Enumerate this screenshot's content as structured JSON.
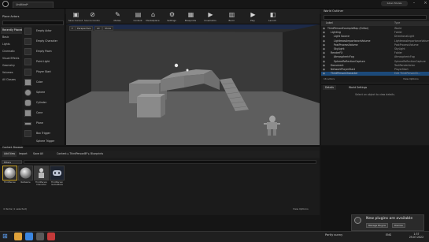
{
  "window": {
    "tab_title": "Untitled*",
    "user": "Iulian Sturza",
    "minimize_icon": "minimize-icon",
    "close_icon": "close-icon"
  },
  "menu": [
    "File",
    "Edit",
    "Window",
    "Help"
  ],
  "place_actors": {
    "title": "Place Actors",
    "categories": [
      "Recently Placed",
      "Basic",
      "Lights",
      "Cinematic",
      "Visual Effects",
      "Geometry",
      "Volumes",
      "All Classes"
    ],
    "items": [
      "Empty Actor",
      "Empty Character",
      "Empty Pawn",
      "Point Light",
      "Player Start",
      "Cube",
      "Sphere",
      "Cylinder",
      "Cone",
      "Plane",
      "Box Trigger",
      "Sphere Trigger"
    ]
  },
  "toolbar": {
    "buttons": [
      {
        "label": "Save Current",
        "icon": "save-icon"
      },
      {
        "label": "Source Control",
        "icon": "source-control-icon"
      },
      {
        "label": "Modes",
        "icon": "modes-icon"
      },
      {
        "label": "Content",
        "icon": "content-icon"
      },
      {
        "label": "Marketplace",
        "icon": "marketplace-icon"
      },
      {
        "label": "Settings",
        "icon": "settings-icon"
      },
      {
        "label": "Blueprints",
        "icon": "blueprints-icon"
      },
      {
        "label": "Cinematics",
        "icon": "cinematics-icon"
      },
      {
        "label": "Build",
        "icon": "build-icon"
      },
      {
        "label": "Play",
        "icon": "play-icon"
      },
      {
        "label": "Launch",
        "icon": "launch-icon"
      }
    ]
  },
  "viewport": {
    "buttons": [
      "Perspective",
      "Lit",
      "Show"
    ]
  },
  "outliner": {
    "title": "World Outliner",
    "columns": {
      "label": "Label",
      "type": "Type"
    },
    "rows": [
      {
        "label": "ThirdPersonExampleMap (Editor)",
        "type": "World",
        "indent": 0
      },
      {
        "label": "Lighting",
        "type": "Folder",
        "indent": 1
      },
      {
        "label": "Light Source",
        "type": "DirectionalLight",
        "indent": 2
      },
      {
        "label": "LightmassImportanceVolume",
        "type": "LightmassImportanceVolume",
        "indent": 2
      },
      {
        "label": "PostProcessVolume",
        "type": "PostProcessVolume",
        "indent": 2
      },
      {
        "label": "SkyLight",
        "type": "SkyLight",
        "indent": 2
      },
      {
        "label": "RenderFX",
        "type": "Folder",
        "indent": 1
      },
      {
        "label": "AtmosphericFog",
        "type": "AtmosphericFog",
        "indent": 2
      },
      {
        "label": "SphereReflectionCapture",
        "type": "SphereReflectionCapture",
        "indent": 2
      },
      {
        "label": "Document",
        "type": "TextRenderActor",
        "indent": 1
      },
      {
        "label": "NetworkPlayerStart",
        "type": "PlayerStart",
        "indent": 1
      },
      {
        "label": "ThirdPersonCharacter",
        "type": "Edit ThirdPersonCh...",
        "indent": 1,
        "selected": true
      }
    ],
    "footer_count": "16 actors",
    "view_options": "View Options"
  },
  "details": {
    "tabs": [
      "Details",
      "World Settings"
    ],
    "empty_text": "Select an object to view details."
  },
  "content_browser": {
    "title": "Content Browser",
    "add_new": "Add New",
    "import": "Import",
    "save_all": "Save All",
    "path": [
      "Content",
      "ThirdPersonBP",
      "Blueprints"
    ],
    "filters": "Filters",
    "assets": [
      {
        "label": "ThirdPerson",
        "selected": true
      },
      {
        "label": "NetGame"
      },
      {
        "label": "ThirdPerson Character"
      },
      {
        "label": "ThirdPerson GameMode"
      }
    ],
    "status": "4 items (1 selected)",
    "view_options": "View Options"
  },
  "notification": {
    "text": "New plugins are available",
    "buttons": [
      "Manage Plugins",
      "Dismiss"
    ],
    "icon": "plugin-icon"
  },
  "taskbar": {
    "weather": "Partly sunny",
    "lang": "ENG",
    "time": "1:37",
    "date": "29.07.2022",
    "apps": [
      {
        "icon": "file-explorer-icon",
        "color": "#e0a23a"
      },
      {
        "icon": "chrome-icon",
        "color": "#3b86e0"
      },
      {
        "icon": "unreal-icon",
        "color": "#5a5a5a"
      },
      {
        "icon": "red-app-icon",
        "color": "#c43a3a"
      }
    ]
  }
}
